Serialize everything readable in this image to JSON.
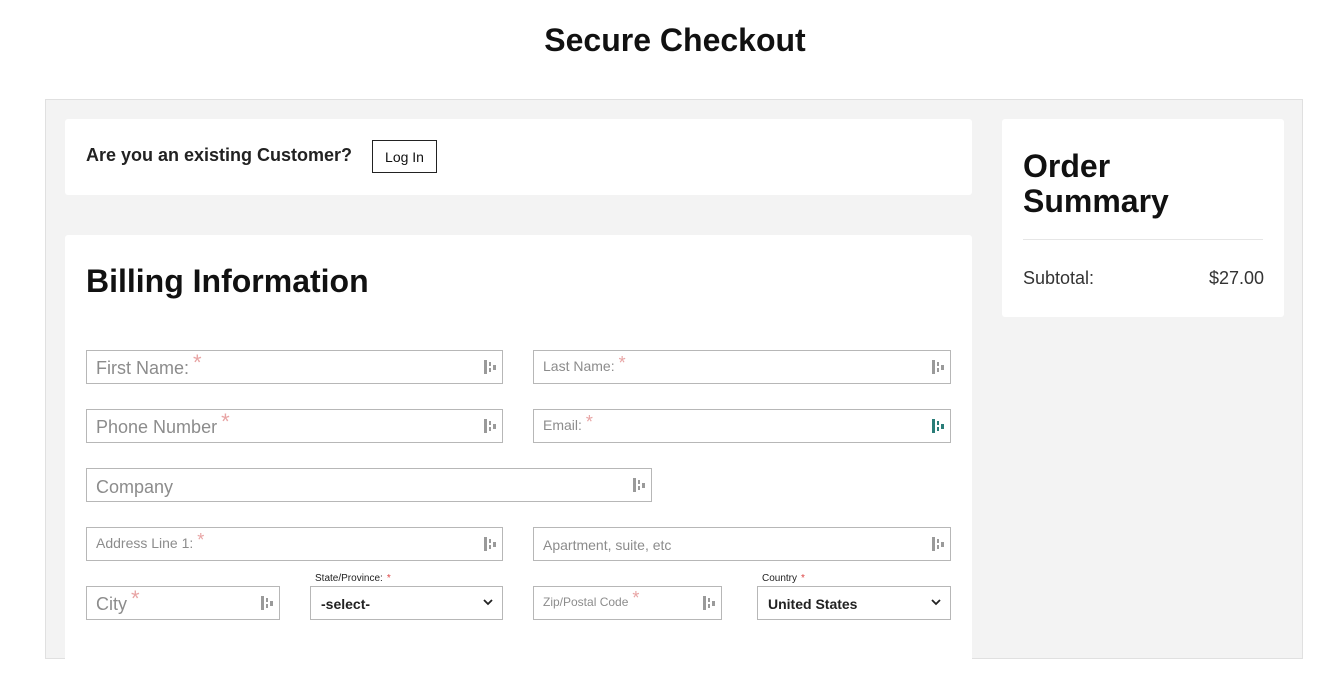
{
  "page": {
    "title": "Secure Checkout"
  },
  "login": {
    "question": "Are you an existing Customer?",
    "button_label": "Log In"
  },
  "billing": {
    "title": "Billing Information",
    "fields": {
      "first_name": "First Name:",
      "last_name": "Last Name:",
      "phone": "Phone Number",
      "email": "Email:",
      "company": "Company",
      "address1": "Address Line 1:",
      "apartment": "Apartment, suite, etc",
      "city": "City",
      "zip": "Zip/Postal Code"
    },
    "required_mark": "*",
    "state": {
      "label": "State/Province:",
      "value": "-select-"
    },
    "country": {
      "label": "Country",
      "value": "United States"
    }
  },
  "summary": {
    "title": "Order Summary",
    "subtotal_label": "Subtotal:",
    "subtotal_value": "$27.00"
  },
  "icons": {
    "autofill": "autofill-key-icon",
    "dropdown": "chevron-down-icon"
  }
}
